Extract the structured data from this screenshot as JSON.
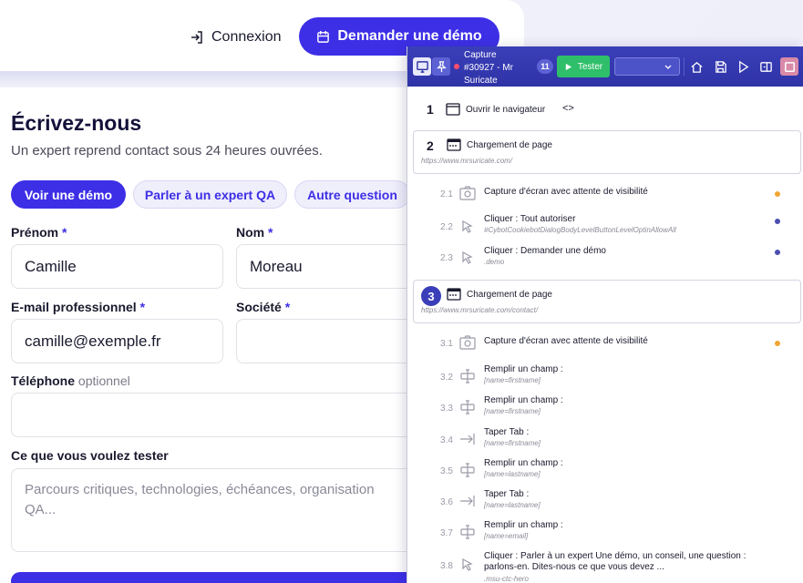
{
  "site": {
    "login_label": "Connexion",
    "demo_cta_label": "Demander une démo",
    "form": {
      "title": "Écrivez-nous",
      "subtitle": "Un expert reprend contact sous 24 heures ouvrées.",
      "tabs": [
        "Voir une démo",
        "Parler à un expert QA",
        "Autre question"
      ],
      "firstname": {
        "label": "Prénom",
        "required_mark": "*",
        "value": "Camille"
      },
      "lastname": {
        "label": "Nom",
        "required_mark": "*",
        "value": "Moreau"
      },
      "email": {
        "label": "E-mail professionnel",
        "required_mark": "*",
        "value": "camille@exemple.fr"
      },
      "company": {
        "label": "Société",
        "required_mark": "*",
        "value": ""
      },
      "phone": {
        "label": "Téléphone",
        "optional_mark": "optionnel",
        "value": ""
      },
      "test_goal": {
        "label": "Ce que vous voulez tester",
        "placeholder": "Parcours critiques, technologies, échéances, organisation QA..."
      }
    }
  },
  "panel": {
    "capture_title": "Capture #30927 - Mr Suricate",
    "step_count": "11",
    "tester_label": "Tester",
    "steps": [
      {
        "number": "1",
        "title": "Ouvrir le navigateur",
        "code_glyph": "<>"
      },
      {
        "number": "2",
        "title": "Chargement de page",
        "url": "https://www.mrsuricate.com/",
        "substeps": [
          {
            "number": "2.1",
            "title": "Capture d'écran avec attente de visibilité",
            "detail": "",
            "dot": "orange"
          },
          {
            "number": "2.2",
            "title": "Cliquer : Tout autoriser",
            "detail": "#CybotCookiebotDialogBodyLevelButtonLevelOptinAllowAll",
            "dot": "blue"
          },
          {
            "number": "2.3",
            "title": "Cliquer : Demander une démo",
            "detail": ".demo",
            "dot": "blue"
          }
        ]
      },
      {
        "number": "3",
        "title": "Chargement de page",
        "url": "https://www.mrsuricate.com/contact/",
        "substeps": [
          {
            "number": "3.1",
            "title": "Capture d'écran avec attente de visibilité",
            "detail": "",
            "dot": "orange"
          },
          {
            "number": "3.2",
            "title": "Remplir un champ :",
            "detail": "[name=firstname]"
          },
          {
            "number": "3.3",
            "title": "Remplir un champ :",
            "detail": "[name=firstname]"
          },
          {
            "number": "3.4",
            "title": "Taper Tab :",
            "detail": "[name=firstname]"
          },
          {
            "number": "3.5",
            "title": "Remplir un champ :",
            "detail": "[name=lastname]"
          },
          {
            "number": "3.6",
            "title": "Taper Tab :",
            "detail": "[name=lastname]"
          },
          {
            "number": "3.7",
            "title": "Remplir un champ :",
            "detail": "[name=email]"
          },
          {
            "number": "3.8",
            "title": "Cliquer : Parler à un expert Une démo, un conseil, une question : parlons-en. Dites-nous ce que vous devez ...",
            "detail": ".msu-ctc-hero"
          }
        ]
      }
    ]
  },
  "colors": {
    "brand": "#3d2fe6",
    "toolbar": "#3a3fb9",
    "tester_green": "#2fbf6a",
    "dot_orange": "#f2a531",
    "dot_blue": "#4b4fb3"
  }
}
